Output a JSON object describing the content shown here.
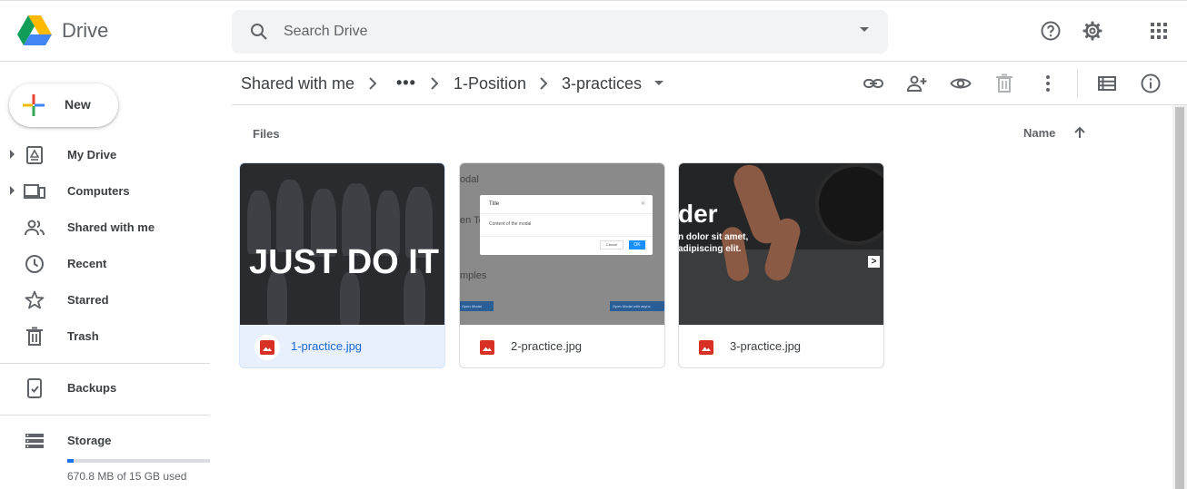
{
  "app": {
    "name": "Drive"
  },
  "search": {
    "placeholder": "Search Drive"
  },
  "new_button": {
    "label": "New"
  },
  "sidebar": {
    "items": [
      {
        "label": "My Drive",
        "icon": "my-drive-icon"
      },
      {
        "label": "Computers",
        "icon": "computers-icon"
      },
      {
        "label": "Shared with me",
        "icon": "shared-icon"
      },
      {
        "label": "Recent",
        "icon": "clock-icon"
      },
      {
        "label": "Starred",
        "icon": "star-icon"
      },
      {
        "label": "Trash",
        "icon": "trash-icon"
      }
    ],
    "backups": {
      "label": "Backups",
      "icon": "backups-icon"
    },
    "storage": {
      "label": "Storage",
      "icon": "storage-icon",
      "used_text": "670.8 MB of 15 GB used",
      "used_fraction": 0.044
    }
  },
  "breadcrumb": {
    "items": [
      "Shared with me",
      "1-Position",
      "3-practices"
    ],
    "overflow": "•••"
  },
  "content": {
    "section_title": "Files",
    "sort_label": "Name",
    "files": [
      {
        "name": "1-practice.jpg",
        "selected": true,
        "thumb_text": "JUST DO IT"
      },
      {
        "name": "2-practice.jpg",
        "selected": false,
        "thumb": {
          "line1": "odal",
          "line2": "en To",
          "line3": "mples",
          "modal_title": "Title",
          "modal_body": "Content of the modal",
          "cancel": "Cancel",
          "ok": "OK",
          "btn1": "Open Modal",
          "btn2": "Open Modal with async"
        }
      },
      {
        "name": "3-practice.jpg",
        "selected": false,
        "thumb": {
          "line1": "der",
          "line2": "n dolor sit amet,",
          "line3": "adipiscing elit.",
          "next": ">"
        }
      }
    ]
  },
  "colors": {
    "accent": "#1a73e8",
    "file_icon_red": "#d93025",
    "selected_bg": "#e8f0fe"
  }
}
